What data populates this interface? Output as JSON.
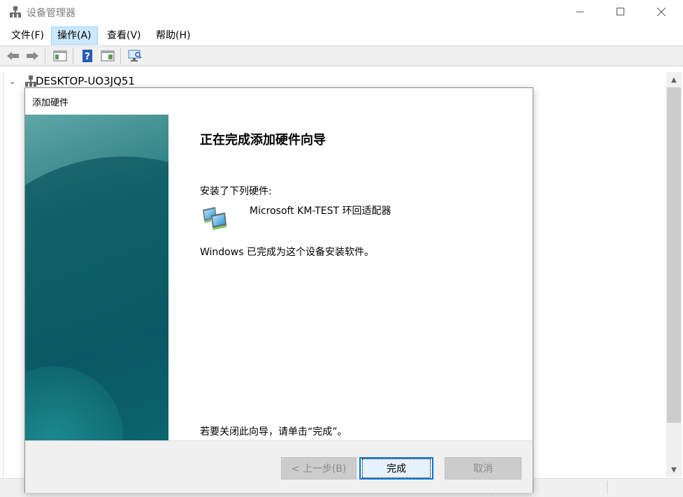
{
  "window": {
    "title": "设备管理器",
    "title_icon": "device-manager-icon"
  },
  "menu": [
    {
      "label": "文件(F)",
      "active": false
    },
    {
      "label": "操作(A)",
      "active": true
    },
    {
      "label": "查看(V)",
      "active": false
    },
    {
      "label": "帮助(H)",
      "active": false
    }
  ],
  "toolbar": {
    "icons": [
      "back-arrow-icon",
      "forward-arrow-icon",
      "show-hide-console-tree-icon",
      "help-icon",
      "properties-icon",
      "scan-hardware-icon"
    ]
  },
  "tree": {
    "root_label": "DESKTOP-UO3JQ51",
    "root_icon": "computer-icon"
  },
  "dialog": {
    "title": "添加硬件",
    "heading": "正在完成添加硬件向导",
    "installed_label": "安装了下列硬件:",
    "hardware_name": "Microsoft KM-TEST 环回适配器",
    "hardware_icon": "network-adapter-icon",
    "done_message": "Windows 已完成为这个设备安装软件。",
    "close_hint": "若要关闭此向导，请单击“完成”。",
    "buttons": {
      "back": "< 上一步(B)",
      "finish": "完成",
      "cancel": "取消"
    }
  },
  "colors": {
    "accent": "#0078d7",
    "menu_highlight": "#cce8ff",
    "banner_teal": "#136b73"
  }
}
